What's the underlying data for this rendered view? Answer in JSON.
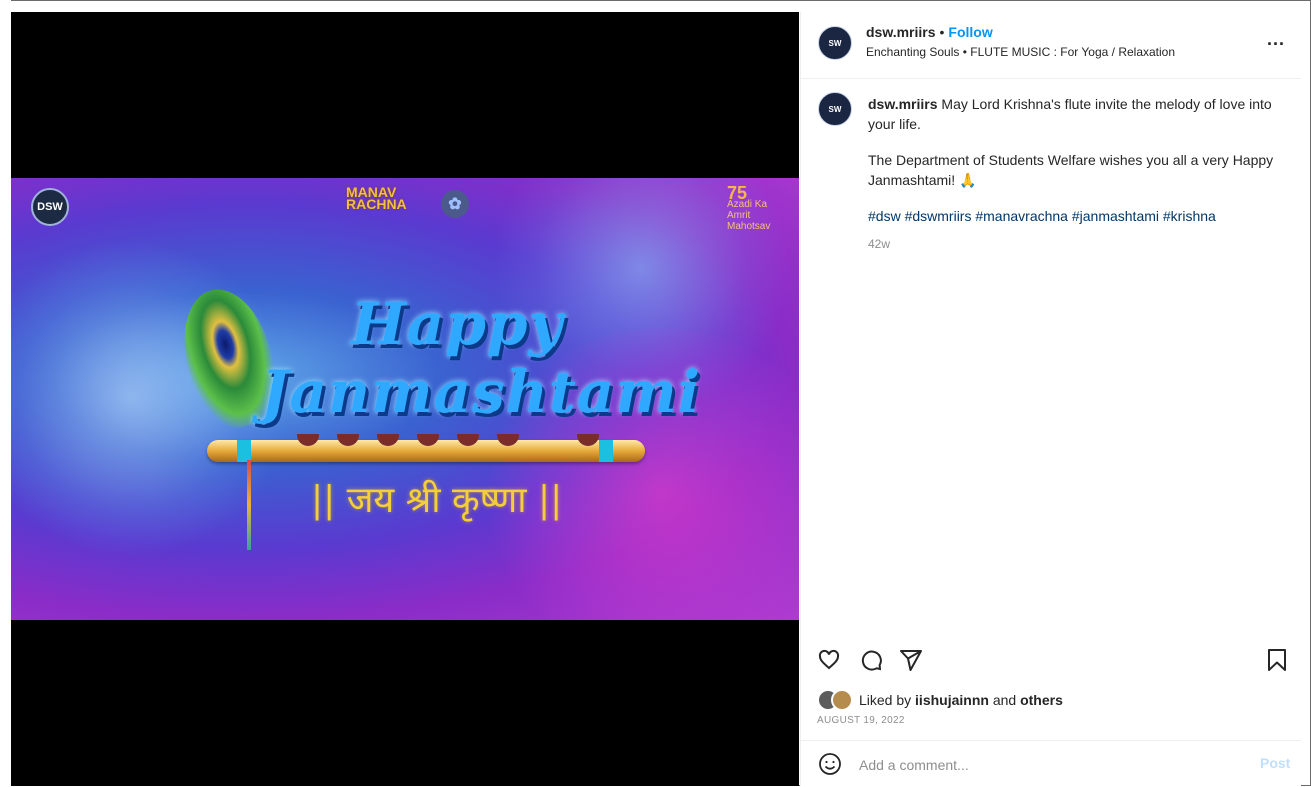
{
  "media": {
    "banner": {
      "top_logo_left": "DSW",
      "top_logo_center": "MANAV RACHNA",
      "top_logo_right_num": "75",
      "top_logo_right_text1": "Azadi Ka",
      "top_logo_right_text2": "Amrit Mahotsav",
      "headline_line1": "Happy",
      "headline_line2": "Janmashtami",
      "hindi_text": "|| जय श्री कृष्णा ||"
    },
    "mute_icon": "muted-speaker-icon"
  },
  "post": {
    "header": {
      "avatar_text": "SW",
      "username": "dsw.mriirs",
      "separator": "•",
      "follow_label": "Follow",
      "audio": "Enchanting Souls • FLUTE MUSIC : For Yoga / Relaxation",
      "more_label": "..."
    },
    "caption": {
      "username": "dsw.mriirs",
      "line1": "May Lord Krishna's flute invite the melody of love into your life.",
      "line2": "The Department of Students Welfare wishes you all a very Happy Janmashtami! 🙏",
      "hashtags": "#dsw #dswmriirs #manavrachna #janmashtami #krishna",
      "time": "42w"
    },
    "actions": {
      "like_icon": "heart-icon",
      "comment_icon": "comment-icon",
      "share_icon": "send-icon",
      "save_icon": "bookmark-icon"
    },
    "likes": {
      "prefix": "Liked by",
      "user": "iishujainnn",
      "middle": "and",
      "others": "others"
    },
    "date": "AUGUST 19, 2022",
    "comment": {
      "placeholder": "Add a comment...",
      "post_label": "Post"
    }
  },
  "colors": {
    "accent": "#0095f6",
    "post_disabled": "#c0dffd",
    "hashtag": "#00376b"
  }
}
